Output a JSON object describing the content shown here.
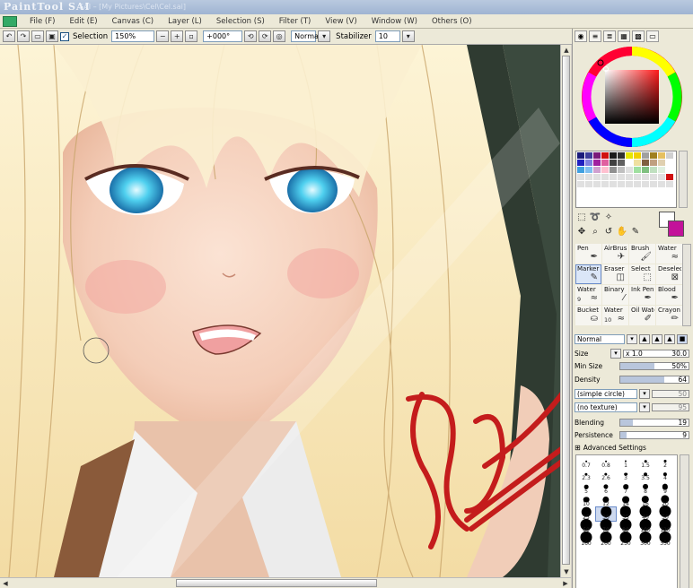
{
  "window": {
    "app_logo": "PaintTool SAI",
    "document_title": "SAI – [My Pictures\\Cel\\Cel.sai]"
  },
  "menu": [
    {
      "label": "File (F)"
    },
    {
      "label": "Edit (E)"
    },
    {
      "label": "Canvas (C)"
    },
    {
      "label": "Layer (L)"
    },
    {
      "label": "Selection (S)"
    },
    {
      "label": "Filter (T)"
    },
    {
      "label": "View (V)"
    },
    {
      "label": "Window (W)"
    },
    {
      "label": "Others (O)"
    }
  ],
  "toolbar": {
    "selection_label": "Selection",
    "selection_checked": true,
    "zoom_value": "150%",
    "rotation_value": "+000°",
    "mode_value": "Normal",
    "stabilizer_label": "Stabilizer",
    "stabilizer_value": "10"
  },
  "tools": {
    "brushes": [
      {
        "name": "Pen",
        "size": "",
        "icon": "pen-icon"
      },
      {
        "name": "AirBrush",
        "size": "",
        "icon": "airbrush-icon"
      },
      {
        "name": "Brush",
        "size": "",
        "icon": "brush-icon"
      },
      {
        "name": "Water",
        "size": "",
        "icon": "water-icon"
      },
      {
        "name": "Marker",
        "size": "",
        "icon": "marker-icon",
        "selected": true
      },
      {
        "name": "Eraser",
        "size": "",
        "icon": "eraser-icon"
      },
      {
        "name": "Select",
        "size": "",
        "icon": "select-icon"
      },
      {
        "name": "Deselect",
        "size": "",
        "icon": "deselect-icon"
      },
      {
        "name": "Water",
        "size": "9",
        "icon": "water-icon"
      },
      {
        "name": "Binary",
        "size": "",
        "icon": "binary-icon"
      },
      {
        "name": "Ink Pen",
        "size": "",
        "icon": "ink-pen-icon"
      },
      {
        "name": "Blood",
        "size": "",
        "icon": "blood-icon"
      },
      {
        "name": "Bucket",
        "size": "",
        "icon": "bucket-icon"
      },
      {
        "name": "Water",
        "size": "10",
        "icon": "water-icon"
      },
      {
        "name": "Oil Water",
        "size": "",
        "icon": "oil-water-icon"
      },
      {
        "name": "Crayon",
        "size": "",
        "icon": "crayon-icon"
      }
    ],
    "blend_mode": "Normal",
    "size_multiplier": "x 1.0",
    "size_label": "Size",
    "size_value": "30.0",
    "min_size_label": "Min Size",
    "min_size_value": "50%",
    "min_size_fraction": 0.5,
    "density_label": "Density",
    "density_value": "64",
    "density_fraction": 0.64,
    "shape_select": "(simple circle)",
    "shape_value": "50",
    "texture_select": "(no texture)",
    "texture_value": "95",
    "blending_label": "Blending",
    "blending_value": "19",
    "blending_fraction": 0.19,
    "persistence_label": "Persistence",
    "persistence_value": "9",
    "persistence_fraction": 0.09,
    "advanced_label": "Advanced Settings",
    "brush_sizes": [
      "0.7",
      "0.8",
      "1",
      "1.5",
      "2",
      "2.3",
      "2.6",
      "3",
      "3.5",
      "4",
      "5",
      "6",
      "7",
      "8",
      "9",
      "10",
      "12",
      "14",
      "16",
      "20",
      "25",
      "30",
      "35",
      "40",
      "50",
      "60",
      "70",
      "80",
      "100",
      "120",
      "160",
      "200",
      "250",
      "300",
      "350"
    ],
    "selected_size": "30"
  },
  "colors": {
    "primary": "#ffffff",
    "secondary": "#c3129a",
    "swatches": [
      "#1a1a7a",
      "#3c3c9a",
      "#7a1a7a",
      "#d01010",
      "#1a1a1a",
      "#303030",
      "#e6e600",
      "#f0d000",
      "#a0a0a0",
      "#a08020",
      "#e6c060",
      "#d0d0d0",
      "#2020c0",
      "#8080e0",
      "#a020a0",
      "#e060a0",
      "#404040",
      "#606060",
      "#ffffff",
      "#f0e0a0",
      "#806040",
      "#c0a080",
      "#e0d0b0",
      "#ffffff",
      "#40a0e0",
      "#80c0f0",
      "#d0a0d0",
      "#ffc0d0",
      "#909090",
      "#c0c0c0",
      "#e0e0e0",
      "#a0e0a0",
      "#80c080",
      "#c0e0c0",
      "#e0f0e0",
      "#ffffff",
      "#e0e0e0",
      "#e0e0e0",
      "#e0e0e0",
      "#e0e0e0",
      "#e0e0e0",
      "#e0e0e0",
      "#e0e0e0",
      "#e0e0e0",
      "#e0e0e0",
      "#e0e0e0",
      "#e0e0e0",
      "#d01010",
      "#e0e0e0",
      "#e0e0e0",
      "#e0e0e0",
      "#e0e0e0",
      "#e0e0e0",
      "#e0e0e0",
      "#e0e0e0",
      "#e0e0e0",
      "#e0e0e0",
      "#e0e0e0",
      "#e0e0e0",
      "#e0e0e0"
    ]
  },
  "canvas": {
    "signature": "handwritten red signature"
  }
}
